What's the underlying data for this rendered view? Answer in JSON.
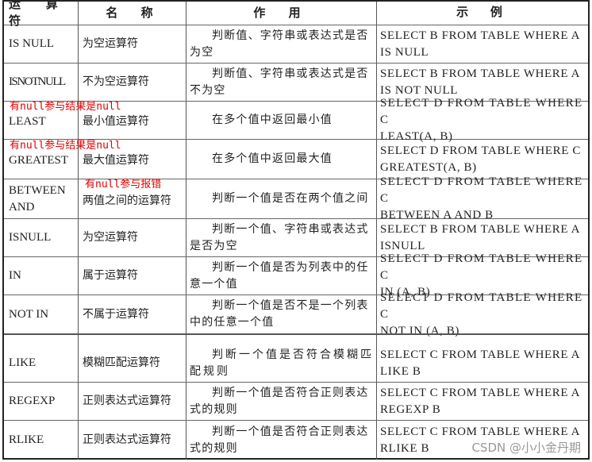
{
  "header": {
    "col1": "运 算 符",
    "col2": "名 称",
    "col3": "作 用",
    "col4": "示 例"
  },
  "rows": [
    {
      "op": "IS NULL",
      "name": "为空运算符",
      "desc": [
        "判断值、字符串或表达式是否",
        "为空"
      ],
      "example": [
        "SELECT B FROM TABLE WHERE A",
        "IS NULL"
      ]
    },
    {
      "op": "ISNOTNULL",
      "name": "不为空运算符",
      "desc": [
        "判断值、字符串或表达式是否",
        "不为空"
      ],
      "example": [
        "SELECT B FROM TABLE WHERE A",
        "IS NOT NULL"
      ]
    },
    {
      "op": "LEAST",
      "name": "最小值运算符",
      "desc": [
        "在多个值中返回最小值"
      ],
      "example": [
        "SELECT D FROM TABLE WHERE C",
        "LEAST(A, B)"
      ]
    },
    {
      "op": "GREATEST",
      "name": "最大值运算符",
      "desc": [
        "在多个值中返回最大值"
      ],
      "example": [
        "SELECT D FROM TABLE WHERE C",
        "GREATEST(A, B)"
      ]
    },
    {
      "op": [
        "BETWEEN",
        "AND"
      ],
      "name": "两值之间的运算符",
      "desc": [
        "判断一个值是否在两个值之间"
      ],
      "example": [
        "SELECT D FROM TABLE WHERE C",
        "BETWEEN A AND B"
      ]
    },
    {
      "op": "ISNULL",
      "name": "为空运算符",
      "desc": [
        "判断一个值、字符串或表达式",
        "是否为空"
      ],
      "example": [
        "SELECT B FROM TABLE WHERE A",
        "ISNULL"
      ]
    },
    {
      "op": "IN",
      "name": "属于运算符",
      "desc": [
        "判断一个值是否为列表中的任",
        "意一个值"
      ],
      "example": [
        "SELECT D FROM TABLE WHERE C",
        "IN (A, B)"
      ]
    },
    {
      "op": "NOT IN",
      "name": "不属于运算符",
      "desc": [
        "判断一个值是否不是一个列表",
        "中的任意一个值"
      ],
      "example": [
        "SELECT D FROM TABLE WHERE C",
        "NOT IN (A, B)"
      ]
    },
    {
      "op": "LIKE",
      "name": "模糊匹配运算符",
      "desc": [
        "判断一个值是否符合模糊匹",
        "配规则"
      ],
      "example": [
        "SELECT C FROM TABLE WHERE A",
        "LIKE B"
      ]
    },
    {
      "op": "REGEXP",
      "name": "正则表达式运算符",
      "desc": [
        "判断一个值是否符合正则表达",
        "式的规则"
      ],
      "example": [
        "SELECT C FROM TABLE WHERE A",
        "REGEXP B"
      ]
    },
    {
      "op": "RLIKE",
      "name": "正则表达式运算符",
      "desc": [
        "判断一个值是否符合正则表达",
        "式的规则"
      ],
      "example": [
        "SELECT C FROM TABLE WHERE A",
        "RLIKE B"
      ]
    }
  ],
  "annotations": {
    "least": "有null参与结果是null",
    "greatest": "有null参与结果是null",
    "between": "有null参与报错"
  },
  "watermark": "CSDN @小小金丹期"
}
